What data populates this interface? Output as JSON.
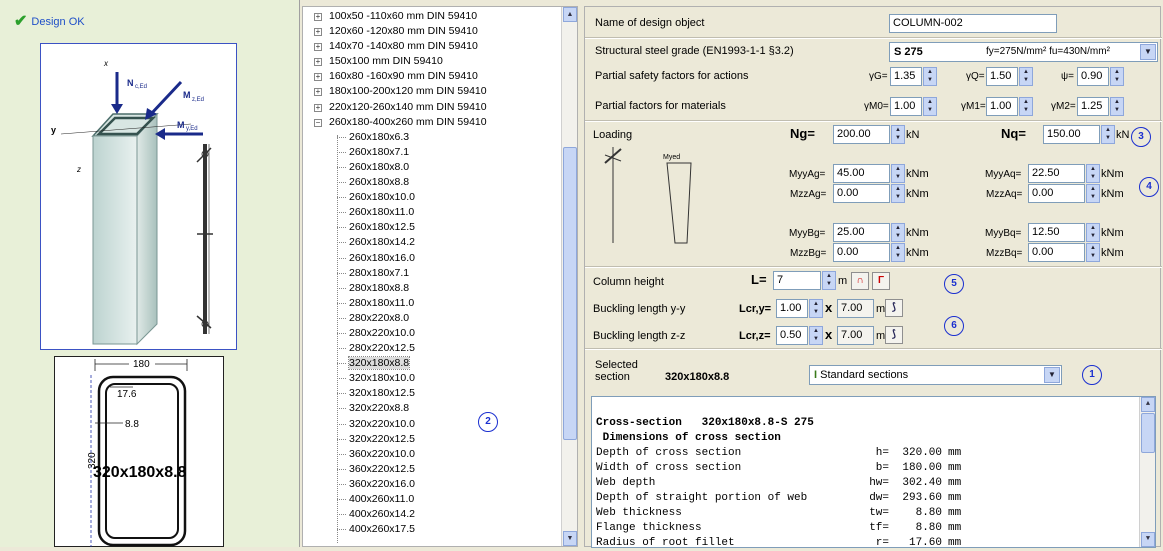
{
  "status": {
    "text": "Design OK"
  },
  "model": {
    "axis_x": "x",
    "axis_y": "y",
    "axis_z": "z",
    "load_n": "N",
    "load_n_sub": "c,Ed",
    "load_mz": "M",
    "load_mz_sub": "z,Ed",
    "load_my": "M",
    "load_my_sub": "y,Ed"
  },
  "section_drawing": {
    "width_dim": "180",
    "height_dim": "320",
    "radius": "17.6",
    "thickness": "8.8",
    "label": "320x180x8.8"
  },
  "tree": {
    "groups": [
      "100x50 -110x60 mm  DIN 59410",
      "120x60 -120x80 mm  DIN 59410",
      "140x70 -140x80 mm  DIN 59410",
      "150x100 mm  DIN 59410",
      "160x80 -160x90 mm  DIN 59410",
      "180x100-200x120 mm  DIN 59410",
      "220x120-260x140 mm  DIN 59410",
      "260x180-400x260 mm  DIN 59410"
    ],
    "children": [
      "260x180x6.3",
      "260x180x7.1",
      "260x180x8.0",
      "260x180x8.8",
      "260x180x10.0",
      "260x180x11.0",
      "260x180x12.5",
      "260x180x14.2",
      "260x180x16.0",
      "280x180x7.1",
      "280x180x8.8",
      "280x180x11.0",
      "280x220x8.0",
      "280x220x10.0",
      "280x220x12.5",
      "320x180x8.8",
      "320x180x10.0",
      "320x180x12.5",
      "320x220x8.8",
      "320x220x10.0",
      "320x220x12.5",
      "360x220x10.0",
      "360x220x12.5",
      "360x220x16.0",
      "400x260x11.0",
      "400x260x14.2",
      "400x260x17.5"
    ],
    "selected": "320x180x8.8",
    "marker": "2"
  },
  "form": {
    "name_label": "Name of design object",
    "name_value": "COLUMN-002",
    "steel_label": "Structural steel grade (EN1993-1-1 §3.2)",
    "steel_value": "S 275",
    "steel_props": "fy=275N/mm² fu=430N/mm²",
    "psf_actions_label": "Partial safety factors for actions",
    "gG_label": "γG=",
    "gG_value": "1.35",
    "gQ_label": "γQ=",
    "gQ_value": "1.50",
    "psi_label": "ψ=",
    "psi_value": "0.90",
    "pf_materials_label": "Partial factors for materials",
    "gM0_label": "γM0=",
    "gM0_value": "1.00",
    "gM1_label": "γM1=",
    "gM1_value": "1.00",
    "gM2_label": "γM2=",
    "gM2_value": "1.25"
  },
  "loading": {
    "label": "Loading",
    "diagram_label": "Myed",
    "Ng_label": "Ng=",
    "Ng_value": "200.00",
    "Nq_label": "Nq=",
    "Nq_value": "150.00",
    "unit_kN": "kN",
    "unit_kNm": "kNm",
    "MyyAg_label": "MyyAg=",
    "MyyAg_value": "45.00",
    "MyyAq_label": "MyyAq=",
    "MyyAq_value": "22.50",
    "MzzAg_label": "MzzAg=",
    "MzzAg_value": "0.00",
    "MzzAq_label": "MzzAq=",
    "MzzAq_value": "0.00",
    "MyyBg_label": "MyyBg=",
    "MyyBg_value": "25.00",
    "MyyBq_label": "MyyBq=",
    "MyyBq_value": "12.50",
    "MzzBg_label": "MzzBg=",
    "MzzBg_value": "0.00",
    "MzzBq_label": "MzzBq=",
    "MzzBq_value": "0.00",
    "marker3": "3",
    "marker4": "4"
  },
  "geometry": {
    "height_label": "Column height",
    "L_label": "L=",
    "L_value": "7",
    "unit_m": "m",
    "buck_y_label": "Buckling length y-y",
    "lcry_label": "Lcr,y=",
    "lcry_value": "1.00",
    "lcry_len": "7.00",
    "buck_z_label": "Buckling length z-z",
    "lcrz_label": "Lcr,z=",
    "lcrz_value": "0.50",
    "lcrz_len": "7.00",
    "times": "x",
    "marker5": "5",
    "marker6": "6"
  },
  "section": {
    "label": "Selected section",
    "value": "320x180x8.8",
    "type_value": "Standard sections",
    "marker1": "1"
  },
  "report": {
    "title": "Cross-section   320x180x8.8-S 275",
    "subtitle": " Dimensions of cross section",
    "rows": [
      {
        "name": "Depth of cross section",
        "sym": "h=",
        "val": "320.00",
        "unit": "mm"
      },
      {
        "name": "Width of cross section",
        "sym": "b=",
        "val": "180.00",
        "unit": "mm"
      },
      {
        "name": "Web depth",
        "sym": "hw=",
        "val": "302.40",
        "unit": "mm"
      },
      {
        "name": "Depth of straight portion of web",
        "sym": "dw=",
        "val": "293.60",
        "unit": "mm"
      },
      {
        "name": "Web thickness",
        "sym": "tw=",
        "val": "8.80",
        "unit": "mm"
      },
      {
        "name": "Flange thickness",
        "sym": "tf=",
        "val": "8.80",
        "unit": "mm"
      },
      {
        "name": "Radius of root fillet",
        "sym": "r=",
        "val": "17.60",
        "unit": "mm"
      }
    ]
  }
}
